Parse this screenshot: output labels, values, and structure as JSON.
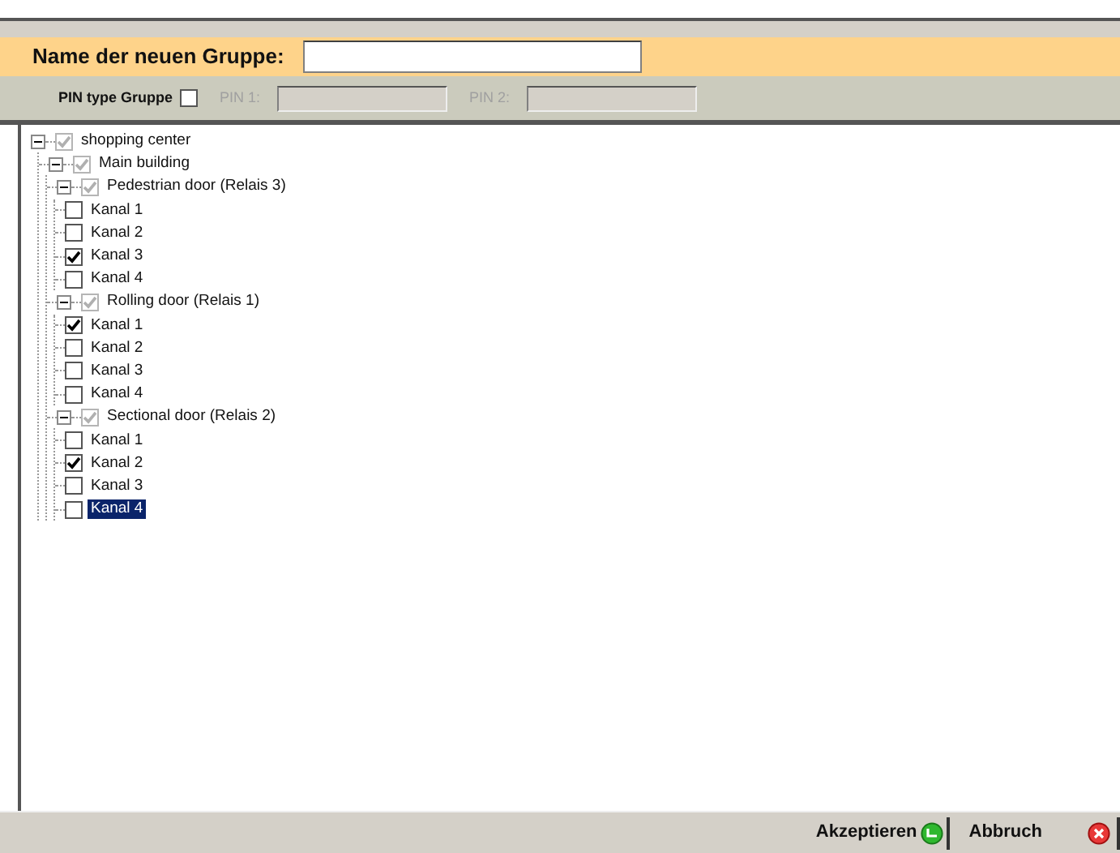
{
  "name_field": {
    "label": "Name der neuen Gruppe:"
  },
  "pin": {
    "label": "PIN type Gruppe",
    "checked": false,
    "pin1_label": "PIN 1:",
    "pin1_disabled": true,
    "pin2_label": "PIN 2:",
    "pin2_disabled": true
  },
  "tree": [
    {
      "label": "shopping center",
      "checked": true,
      "disabled": true,
      "expanded": true,
      "selected": false,
      "children": [
        {
          "label": "Main building",
          "checked": true,
          "disabled": true,
          "expanded": true,
          "selected": false,
          "children": [
            {
              "label": "Pedestrian door (Relais 3)",
              "checked": true,
              "disabled": true,
              "expanded": true,
              "selected": false,
              "children": [
                {
                  "label": "Kanal 1",
                  "checked": false,
                  "disabled": false,
                  "selected": false
                },
                {
                  "label": "Kanal 2",
                  "checked": false,
                  "disabled": false,
                  "selected": false
                },
                {
                  "label": "Kanal 3",
                  "checked": true,
                  "disabled": false,
                  "selected": false
                },
                {
                  "label": "Kanal 4",
                  "checked": false,
                  "disabled": false,
                  "selected": false
                }
              ]
            },
            {
              "label": "Rolling door (Relais 1)",
              "checked": true,
              "disabled": true,
              "expanded": true,
              "selected": false,
              "children": [
                {
                  "label": "Kanal 1",
                  "checked": true,
                  "disabled": false,
                  "selected": false
                },
                {
                  "label": "Kanal 2",
                  "checked": false,
                  "disabled": false,
                  "selected": false
                },
                {
                  "label": "Kanal 3",
                  "checked": false,
                  "disabled": false,
                  "selected": false
                },
                {
                  "label": "Kanal 4",
                  "checked": false,
                  "disabled": false,
                  "selected": false
                }
              ]
            },
            {
              "label": "Sectional door (Relais 2)",
              "checked": true,
              "disabled": true,
              "expanded": true,
              "selected": false,
              "children": [
                {
                  "label": "Kanal 1",
                  "checked": false,
                  "disabled": false,
                  "selected": false
                },
                {
                  "label": "Kanal 2",
                  "checked": true,
                  "disabled": false,
                  "selected": false
                },
                {
                  "label": "Kanal 3",
                  "checked": false,
                  "disabled": false,
                  "selected": false
                },
                {
                  "label": "Kanal 4",
                  "checked": false,
                  "disabled": false,
                  "selected": true
                }
              ]
            }
          ]
        }
      ]
    }
  ],
  "buttons": [
    {
      "label": "Akzeptieren",
      "kind": "accept"
    },
    {
      "label": "Abbruch",
      "kind": "cancel"
    }
  ]
}
